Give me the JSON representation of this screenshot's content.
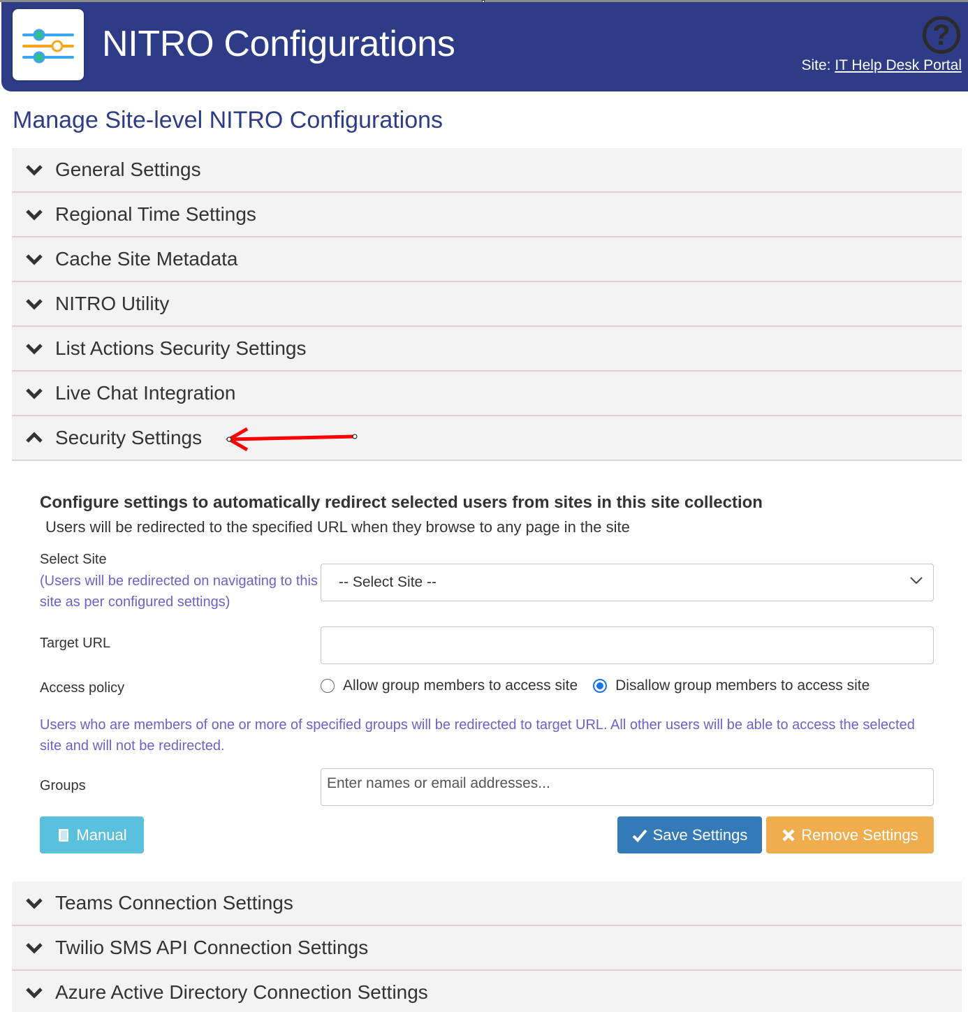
{
  "header": {
    "app_title": "NITRO Configurations",
    "logo_icon": "sliders-icon",
    "help_icon": "question-circle-icon",
    "site_label": "Site:",
    "site_link": "IT Help Desk Portal"
  },
  "page_title": "Manage Site-level NITRO Configurations",
  "accordion_top": [
    {
      "label": "General Settings",
      "expanded": false
    },
    {
      "label": "Regional Time Settings",
      "expanded": false
    },
    {
      "label": "Cache Site Metadata",
      "expanded": false
    },
    {
      "label": "NITRO Utility",
      "expanded": false
    },
    {
      "label": "List Actions Security Settings",
      "expanded": false
    },
    {
      "label": "Live Chat Integration",
      "expanded": false
    },
    {
      "label": "Security Settings",
      "expanded": true
    }
  ],
  "security": {
    "title": "Configure settings to automatically redirect selected users from sites in this site collection",
    "subtitle": "Users will be redirected to the specified URL when they browse to any page in the site",
    "select_site_label": "Select Site",
    "select_site_hint": "(Users will be redirected on navigating to this site as per configured settings)",
    "select_site_value": "-- Select Site --",
    "target_url_label": "Target URL",
    "target_url_value": "",
    "access_policy_label": "Access policy",
    "access_options": [
      {
        "label": "Allow group members to access site",
        "checked": false
      },
      {
        "label": "Disallow group members to access site",
        "checked": true
      }
    ],
    "policy_hint": "Users who are members of one or more of specified groups will be redirected to target URL. All other users will be able to access the selected site and will not be redirected.",
    "groups_label": "Groups",
    "groups_placeholder": "Enter names or email addresses...",
    "buttons": {
      "manual": "Manual",
      "save": "Save Settings",
      "remove": "Remove Settings"
    }
  },
  "accordion_bottom": [
    {
      "label": "Teams Connection Settings",
      "expanded": false
    },
    {
      "label": "Twilio SMS API Connection Settings",
      "expanded": false
    },
    {
      "label": "Azure Active Directory Connection Settings",
      "expanded": false
    }
  ],
  "colors": {
    "header_bg": "#2e3c87",
    "page_title": "#2e3c87",
    "hint_text": "#6b62c9",
    "manual_btn": "#5bc0de",
    "save_btn": "#337ab7",
    "remove_btn": "#f0ad4e",
    "annotation_arrow": "#ff0000"
  }
}
